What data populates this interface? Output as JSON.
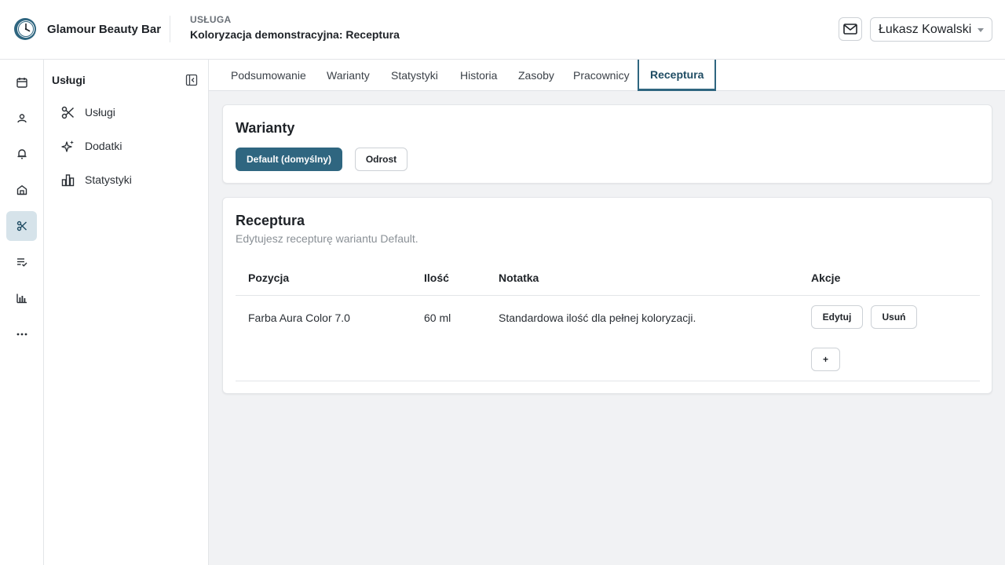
{
  "app": {
    "brand": "Glamour Beauty Bar"
  },
  "header": {
    "kicker": "USŁUGA",
    "title": "Koloryzacja demonstracyjna: Receptura",
    "user": "Łukasz Kowalski"
  },
  "rail": {
    "items": [
      {
        "icon": "calendar-icon"
      },
      {
        "icon": "clients-icon"
      },
      {
        "icon": "bell-icon"
      },
      {
        "icon": "store-icon"
      },
      {
        "icon": "scissors-icon",
        "active": true
      },
      {
        "icon": "checklist-icon"
      },
      {
        "icon": "bar-chart-icon"
      },
      {
        "icon": "more-icon"
      }
    ]
  },
  "subnav": {
    "title": "Usługi",
    "items": [
      {
        "label": "Usługi",
        "icon": "scissors-icon"
      },
      {
        "label": "Dodatki",
        "icon": "sparkles-icon"
      },
      {
        "label": "Statystyki",
        "icon": "bar-chart-icon"
      }
    ]
  },
  "tabs": [
    {
      "label": "Podsumowanie"
    },
    {
      "label": "Warianty"
    },
    {
      "label": "Statystyki"
    },
    {
      "label": "Historia"
    },
    {
      "label": "Zasoby"
    },
    {
      "label": "Pracownicy"
    },
    {
      "label": "Receptura",
      "active": true
    }
  ],
  "variants": {
    "title": "Warianty",
    "buttons": [
      {
        "label": "Default (domyślny)",
        "selected": true
      },
      {
        "label": "Odrost",
        "selected": false
      }
    ]
  },
  "recipe": {
    "title": "Receptura",
    "subtitle": "Edytujesz recepturę wariantu Default.",
    "columns": [
      "Pozycja",
      "Ilość",
      "Notatka",
      "Akcje"
    ],
    "rows": [
      {
        "item": "Farba Aura Color 7.0",
        "qty": "60 ml",
        "note": "Standardowa ilość dla pełnej koloryzacji.",
        "edit": "Edytuj",
        "delete": "Usuń"
      }
    ],
    "add_label": "+"
  },
  "colors": {
    "accent": "#2f6680",
    "active_rail": "#d6e3ea",
    "background": "#f1f2f4"
  }
}
